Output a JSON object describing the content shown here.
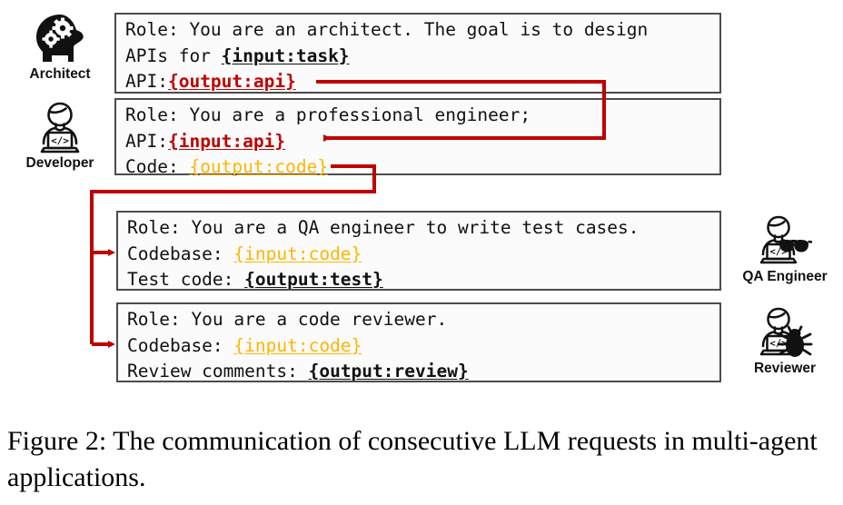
{
  "figure": {
    "caption": "Figure 2: The communication of consecutive LLM requests in multi-agent applications."
  },
  "colors": {
    "red": "#c00000",
    "orange": "#ffb400",
    "black": "#111111",
    "box_border": "#4c4c4c",
    "box_fill": "#fbfbfb"
  },
  "agents": [
    {
      "id": "architect",
      "label": "Architect",
      "icon": "head-with-gears-icon"
    },
    {
      "id": "developer",
      "label": "Developer",
      "icon": "developer-laptop-icon"
    },
    {
      "id": "qa-engineer",
      "label": "QA Engineer",
      "icon": "qa-engineer-glasses-icon"
    },
    {
      "id": "reviewer",
      "label": "Reviewer",
      "icon": "reviewer-bug-icon"
    }
  ],
  "prompts": {
    "architect": {
      "line1": "Role: You are an architect. The goal is to design",
      "line2_prefix": "APIs for ",
      "line2_token": "{input:task}",
      "line3_prefix": "API:",
      "line3_token": "{output:api}"
    },
    "developer": {
      "line1": "Role: You are a professional engineer;",
      "line2_prefix": "API:",
      "line2_token": "{input:api}",
      "line3_prefix": "Code: ",
      "line3_token": "{output:code}"
    },
    "qa_engineer": {
      "line1": "Role: You are a QA engineer to write test cases.",
      "line2_prefix": "Codebase: ",
      "line2_token": "{input:code}",
      "line3_prefix": "Test code: ",
      "line3_token": "{output:test}"
    },
    "reviewer": {
      "line1": "Role: You are a code reviewer.",
      "line2_prefix": "Codebase: ",
      "line2_token": "{input:code}",
      "line3_prefix": "Review comments: ",
      "line3_token": "{output:review}"
    }
  },
  "flows": [
    {
      "from": "architect.output:api",
      "to": "developer.input:api",
      "color": "#c00000"
    },
    {
      "from": "developer.output:code",
      "to": "qa_engineer.input:code",
      "color": "#c00000"
    },
    {
      "from": "developer.output:code",
      "to": "reviewer.input:code",
      "color": "#c00000"
    }
  ]
}
